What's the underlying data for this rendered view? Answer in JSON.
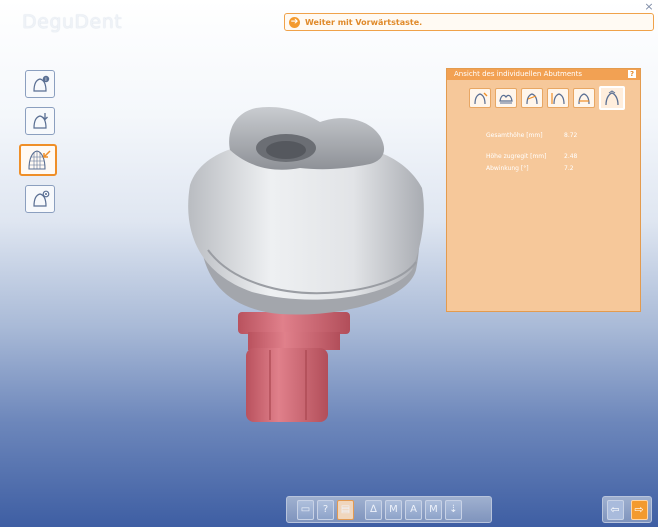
{
  "app": {
    "brand": "DeguDent",
    "close_glyph": "×"
  },
  "hint": {
    "icon": "arrow-right-circle-icon",
    "text": "Weiter mit Vorwärtstaste."
  },
  "side_tools": [
    {
      "icon": "abutment-info-icon",
      "active": false
    },
    {
      "icon": "abutment-download-icon",
      "active": false
    },
    {
      "icon": "mesh-edit-icon",
      "active": true
    },
    {
      "icon": "abutment-settings-icon",
      "active": false
    }
  ],
  "panel": {
    "title": "Ansicht des individuellen Abutments",
    "help_glyph": "?",
    "icons": [
      "margin-view-icon",
      "emergence-view-icon",
      "angle-view-icon",
      "height-view-icon",
      "shoulder-view-icon",
      "full-view-icon"
    ],
    "properties": [
      {
        "label": "Gesamthöhe [mm]",
        "value": "8.72"
      },
      {
        "label": "Höhe zugregit [mm]",
        "value": "2.48"
      },
      {
        "label": "Abwinkung [°]",
        "value": "7.2"
      }
    ]
  },
  "toolbar": {
    "buttons": [
      "save-icon",
      "help-icon",
      "layers-icon",
      "view-front-icon",
      "view-m-icon",
      "view-a-icon",
      "view-mesh-icon",
      "view-pin-icon"
    ],
    "help_glyph": "?"
  },
  "nav": {
    "back": "back-arrow-icon",
    "forward": "forward-arrow-icon"
  },
  "colors": {
    "accent": "#f39a2e",
    "panel": "#f6c89a",
    "abutment_gray": "#e4e6e9",
    "implant_red": "#d9707c"
  }
}
